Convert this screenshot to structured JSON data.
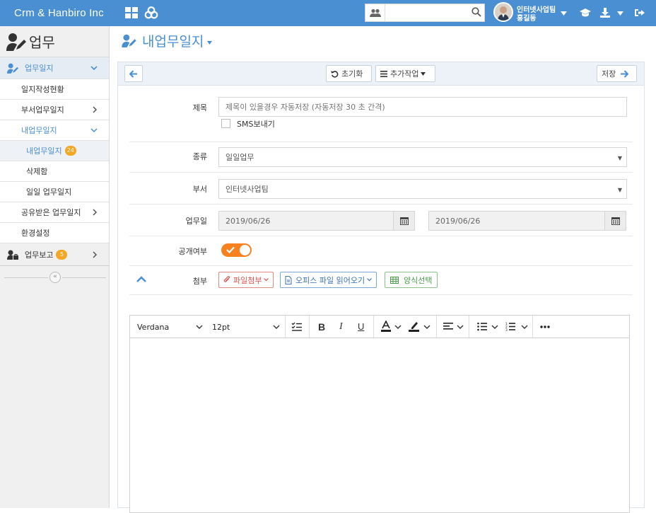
{
  "topbar": {
    "brand": "Crm & Hanbiro Inc",
    "search_placeholder": "",
    "user_dept": "인터넷사업팀",
    "user_name": "홍길동"
  },
  "sidebar": {
    "title": "업무",
    "items": [
      {
        "label": "업무일지"
      },
      {
        "label": "일지작성현황"
      },
      {
        "label": "부서업무일지"
      },
      {
        "label": "내업무일지"
      },
      {
        "label": "내업무일지",
        "badge": "24"
      },
      {
        "label": "삭제함"
      },
      {
        "label": "일일 업무일지"
      },
      {
        "label": "공유받은 업무일지"
      },
      {
        "label": "환경설정"
      },
      {
        "label": "업무보고",
        "badge": "5"
      }
    ],
    "collapse_label": "«"
  },
  "page": {
    "title": "내업무일지"
  },
  "toolbar": {
    "reset_label": "초기화",
    "more_label": "추가작업",
    "save_label": "저장"
  },
  "form": {
    "subject_label": "제목",
    "subject_placeholder": "제목이 있을경우 자동저장 (자동저장 30 초 간격)",
    "sms_label": "SMS보내기",
    "type_label": "종류",
    "type_value": "일일업무",
    "dept_label": "부서",
    "dept_value": "인터넷사업팀",
    "date_label": "업무일",
    "date_start": "2019/06/26",
    "date_end": "2019/06/26",
    "public_label": "공개여부",
    "attach_label": "첨부",
    "attach_file": "파일첨부",
    "attach_office": "오피스 파일 읽어오기",
    "attach_template": "양식선택"
  },
  "editor": {
    "font": "Verdana",
    "size": "12pt"
  },
  "colors": {
    "accent": "#4a8fd2",
    "toggle": "#f7801f",
    "badge": "#f5a623"
  }
}
